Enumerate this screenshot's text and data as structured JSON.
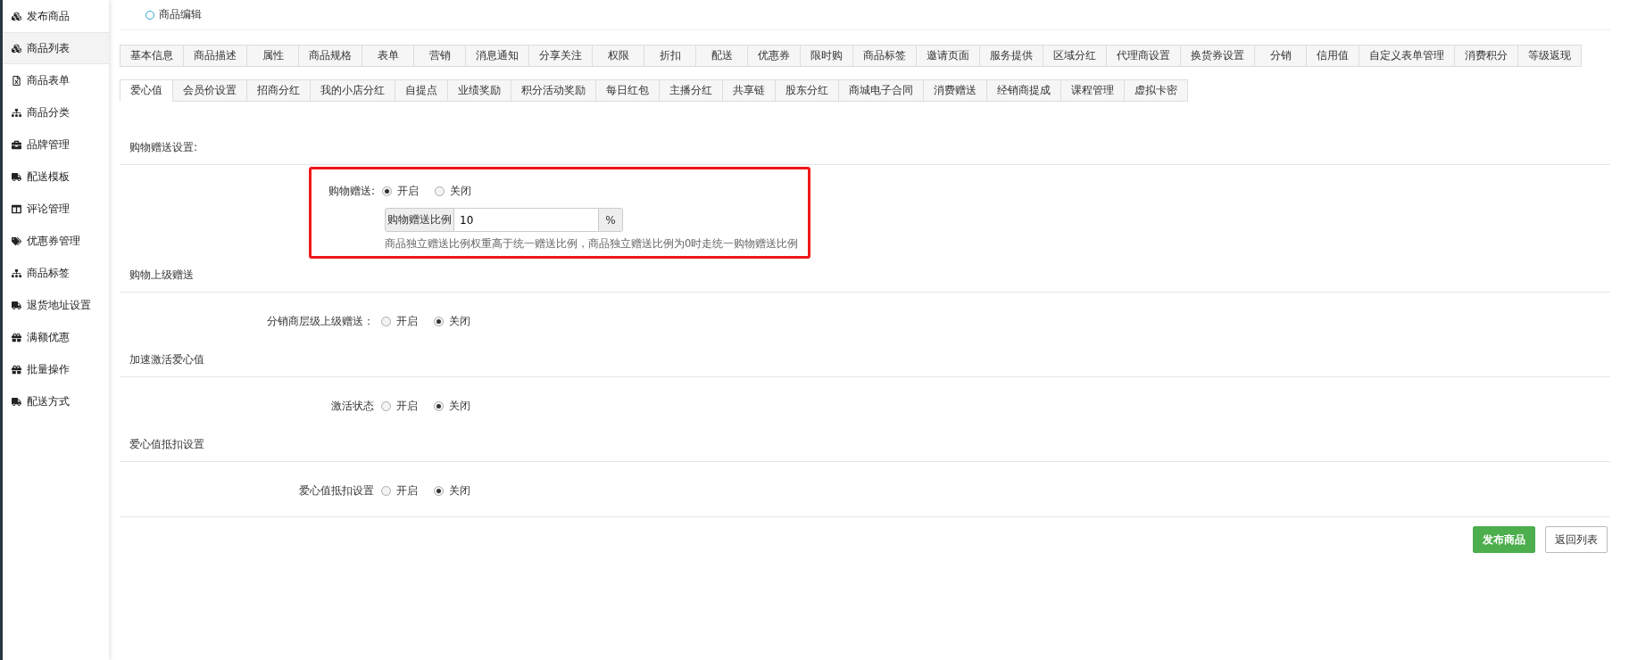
{
  "sidebar": {
    "items": [
      {
        "label": "发布商品",
        "kind": "cubes",
        "selected": false
      },
      {
        "label": "商品列表",
        "kind": "cubes",
        "selected": true
      },
      {
        "label": "商品表单",
        "kind": "file",
        "selected": false
      },
      {
        "label": "商品分类",
        "kind": "sitemap",
        "selected": false
      },
      {
        "label": "品牌管理",
        "kind": "briefcase",
        "selected": false
      },
      {
        "label": "配送模板",
        "kind": "truck",
        "selected": false
      },
      {
        "label": "评论管理",
        "kind": "columns",
        "selected": false
      },
      {
        "label": "优惠券管理",
        "kind": "tags",
        "selected": false
      },
      {
        "label": "商品标签",
        "kind": "sitemap",
        "selected": false
      },
      {
        "label": "退货地址设置",
        "kind": "truck",
        "selected": false
      },
      {
        "label": "满额优惠",
        "kind": "gift",
        "selected": false
      },
      {
        "label": "批量操作",
        "kind": "gift",
        "selected": false
      },
      {
        "label": "配送方式",
        "kind": "truck",
        "selected": false
      }
    ]
  },
  "page_title": "商品编辑",
  "tabs_row_1": [
    {
      "label": "基本信息",
      "selected": false
    },
    {
      "label": "商品描述",
      "selected": false
    },
    {
      "label": "属性",
      "selected": false
    },
    {
      "label": "商品规格",
      "selected": false
    },
    {
      "label": "表单",
      "selected": false
    },
    {
      "label": "营销",
      "selected": false
    },
    {
      "label": "消息通知",
      "selected": false
    },
    {
      "label": "分享关注",
      "selected": false
    },
    {
      "label": "权限",
      "selected": false
    },
    {
      "label": "折扣",
      "selected": false
    },
    {
      "label": "配送",
      "selected": false
    },
    {
      "label": "优惠券",
      "selected": false
    },
    {
      "label": "限时购",
      "selected": false
    },
    {
      "label": "商品标签",
      "selected": false
    },
    {
      "label": "邀请页面",
      "selected": false
    },
    {
      "label": "服务提供",
      "selected": false
    },
    {
      "label": "区域分红",
      "selected": false
    },
    {
      "label": "代理商设置",
      "selected": false
    },
    {
      "label": "换货券设置",
      "selected": false
    },
    {
      "label": "分销",
      "selected": false
    },
    {
      "label": "信用值",
      "selected": false
    },
    {
      "label": "自定义表单管理",
      "selected": false
    },
    {
      "label": "消费积分",
      "selected": false
    },
    {
      "label": "等级返现",
      "selected": false
    }
  ],
  "tabs_row_2": [
    {
      "label": "爱心值",
      "selected": true
    },
    {
      "label": "会员价设置",
      "selected": false
    },
    {
      "label": "招商分红",
      "selected": false
    },
    {
      "label": "我的小店分红",
      "selected": false
    },
    {
      "label": "自提点",
      "selected": false
    },
    {
      "label": "业绩奖励",
      "selected": false
    },
    {
      "label": "积分活动奖励",
      "selected": false
    },
    {
      "label": "每日红包",
      "selected": false
    },
    {
      "label": "主播分红",
      "selected": false
    },
    {
      "label": "共享链",
      "selected": false
    },
    {
      "label": "股东分红",
      "selected": false
    },
    {
      "label": "商城电子合同",
      "selected": false
    },
    {
      "label": "消费赠送",
      "selected": false
    },
    {
      "label": "经销商提成",
      "selected": false
    },
    {
      "label": "课程管理",
      "selected": false
    },
    {
      "label": "虚拟卡密",
      "selected": false
    }
  ],
  "sections": [
    {
      "title": "购物赠送设置:",
      "highlighted": true,
      "rows": [
        {
          "label": "购物赠送:",
          "options": [
            {
              "label": "开启",
              "selected": true
            },
            {
              "label": "关闭",
              "selected": false
            }
          ]
        }
      ],
      "ratio": {
        "addon": "购物赠送比例",
        "value": "10",
        "suffix": "%"
      },
      "help": "商品独立赠送比例权重高于统一赠送比例，商品独立赠送比例为0时走统一购物赠送比例"
    },
    {
      "title": "购物上级赠送",
      "highlighted": false,
      "rows": [
        {
          "label": "分销商层级上级赠送：",
          "options": [
            {
              "label": "开启",
              "selected": false
            },
            {
              "label": "关闭",
              "selected": true
            }
          ]
        }
      ]
    },
    {
      "title": "加速激活爱心值",
      "highlighted": false,
      "rows": [
        {
          "label": "激活状态",
          "options": [
            {
              "label": "开启",
              "selected": false
            },
            {
              "label": "关闭",
              "selected": true
            }
          ]
        }
      ]
    },
    {
      "title": "爱心值抵扣设置",
      "highlighted": false,
      "rows": [
        {
          "label": "爱心值抵扣设置",
          "options": [
            {
              "label": "开启",
              "selected": false
            },
            {
              "label": "关闭",
              "selected": true
            }
          ]
        }
      ]
    }
  ],
  "buttons": [
    {
      "label": "发布商品",
      "kind": "primary"
    },
    {
      "label": "返回列表",
      "kind": "default"
    }
  ]
}
